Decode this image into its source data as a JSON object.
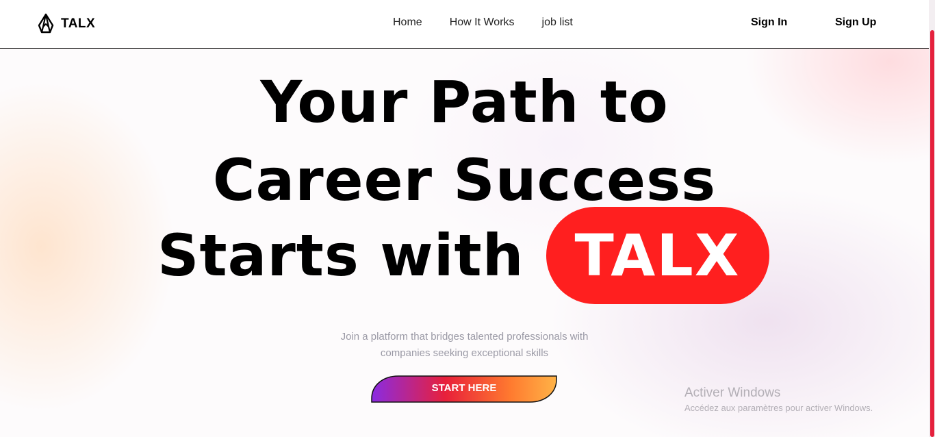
{
  "header": {
    "brand": "TALX",
    "nav": {
      "home": "Home",
      "how_it_works": "How It Works",
      "job_list": "job list"
    },
    "sign_in": "Sign In",
    "sign_up": "Sign Up"
  },
  "hero": {
    "line1": "Your Path to",
    "line2": "Career Success",
    "line3": "Starts with",
    "highlight": "TALX",
    "subtitle_line1": "Join a platform that bridges talented professionals with",
    "subtitle_line2": "companies seeking exceptional skills",
    "cta": "START HERE"
  },
  "watermark": {
    "title": "Activer Windows",
    "subtitle": "Accédez aux paramètres pour activer Windows."
  },
  "colors": {
    "accent_red": "#ff1f1f",
    "cta_gradient": [
      "#8a2be2",
      "#e8203a",
      "#ff7a2f",
      "#ffb347"
    ],
    "scroll_thumb": "#e5213d"
  },
  "icons": {
    "logo": "talx-logo-icon"
  }
}
